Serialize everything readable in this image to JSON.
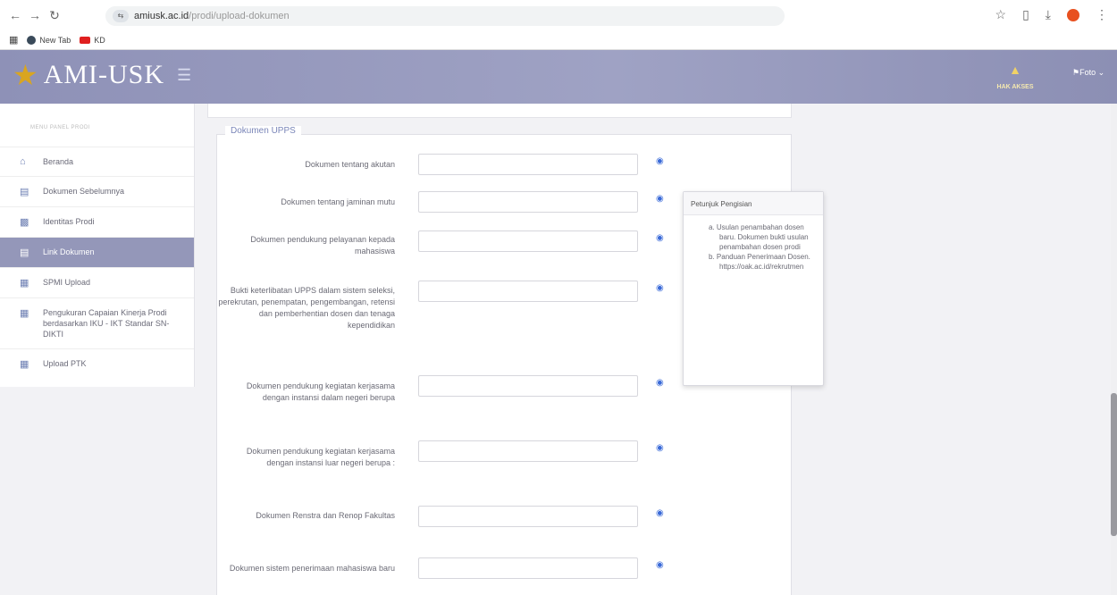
{
  "browser": {
    "url_host": "amiusk.ac.id",
    "url_path": "/prodi/upload-dokumen",
    "bookmarks": [
      "New Tab",
      "KD"
    ]
  },
  "header": {
    "app_name": "AMI-USK",
    "user_label": "HAK AKSES",
    "lang_label": "Foto"
  },
  "sidebar": {
    "section_title": "MENU PANEL PRODI",
    "items": [
      {
        "label": "Beranda",
        "icon": "home-icon",
        "active": false
      },
      {
        "label": "Dokumen Sebelumnya",
        "icon": "document-icon",
        "active": false
      },
      {
        "label": "Identitas Prodi",
        "icon": "id-card-icon",
        "active": false
      },
      {
        "label": "Link Dokumen",
        "icon": "link-document-icon",
        "active": true
      },
      {
        "label": "SPMI Upload",
        "icon": "calendar-icon",
        "active": false
      },
      {
        "label": "Pengukuran Capaian Kinerja Prodi berdasarkan IKU - IKT Standar SN-DIKTI",
        "icon": "calendar-icon",
        "active": false
      },
      {
        "label": "Upload PTK",
        "icon": "calendar-icon",
        "active": false
      }
    ]
  },
  "form": {
    "legend": "Dokumen UPPS",
    "view_icon_label": "◉",
    "fields": [
      {
        "label": "Dokumen tentang akutan",
        "value": ""
      },
      {
        "label": "Dokumen tentang jaminan mutu",
        "value": ""
      },
      {
        "label": "Dokumen pendukung pelayanan kepada mahasiswa",
        "value": ""
      },
      {
        "label": "Bukti keterlibatan UPPS dalam sistem seleksi, perekrutan, penempatan, pengembangan, retensi dan pemberhentian dosen dan tenaga kependidikan",
        "value": ""
      },
      {
        "label": "Dokumen pendukung kegiatan kerjasama dengan instansi dalam negeri berupa",
        "value": ""
      },
      {
        "label": "Dokumen pendukung kegiatan kerjasama dengan instansi luar negeri berupa :",
        "value": ""
      },
      {
        "label": "Dokumen Renstra dan Renop Fakultas",
        "value": ""
      },
      {
        "label": "Dokumen sistem penerimaan mahasiswa baru",
        "value": ""
      }
    ]
  },
  "tooltip": {
    "title": "Petunjuk Pengisian",
    "items": [
      {
        "marker": "a.",
        "text": "Usulan penambahan dosen baru. Dokumen bukti usulan penambahan dosen prodi"
      },
      {
        "marker": "b.",
        "text": "Panduan Penerimaan Dosen. https://oak.ac.id/rekrutmen"
      }
    ]
  }
}
